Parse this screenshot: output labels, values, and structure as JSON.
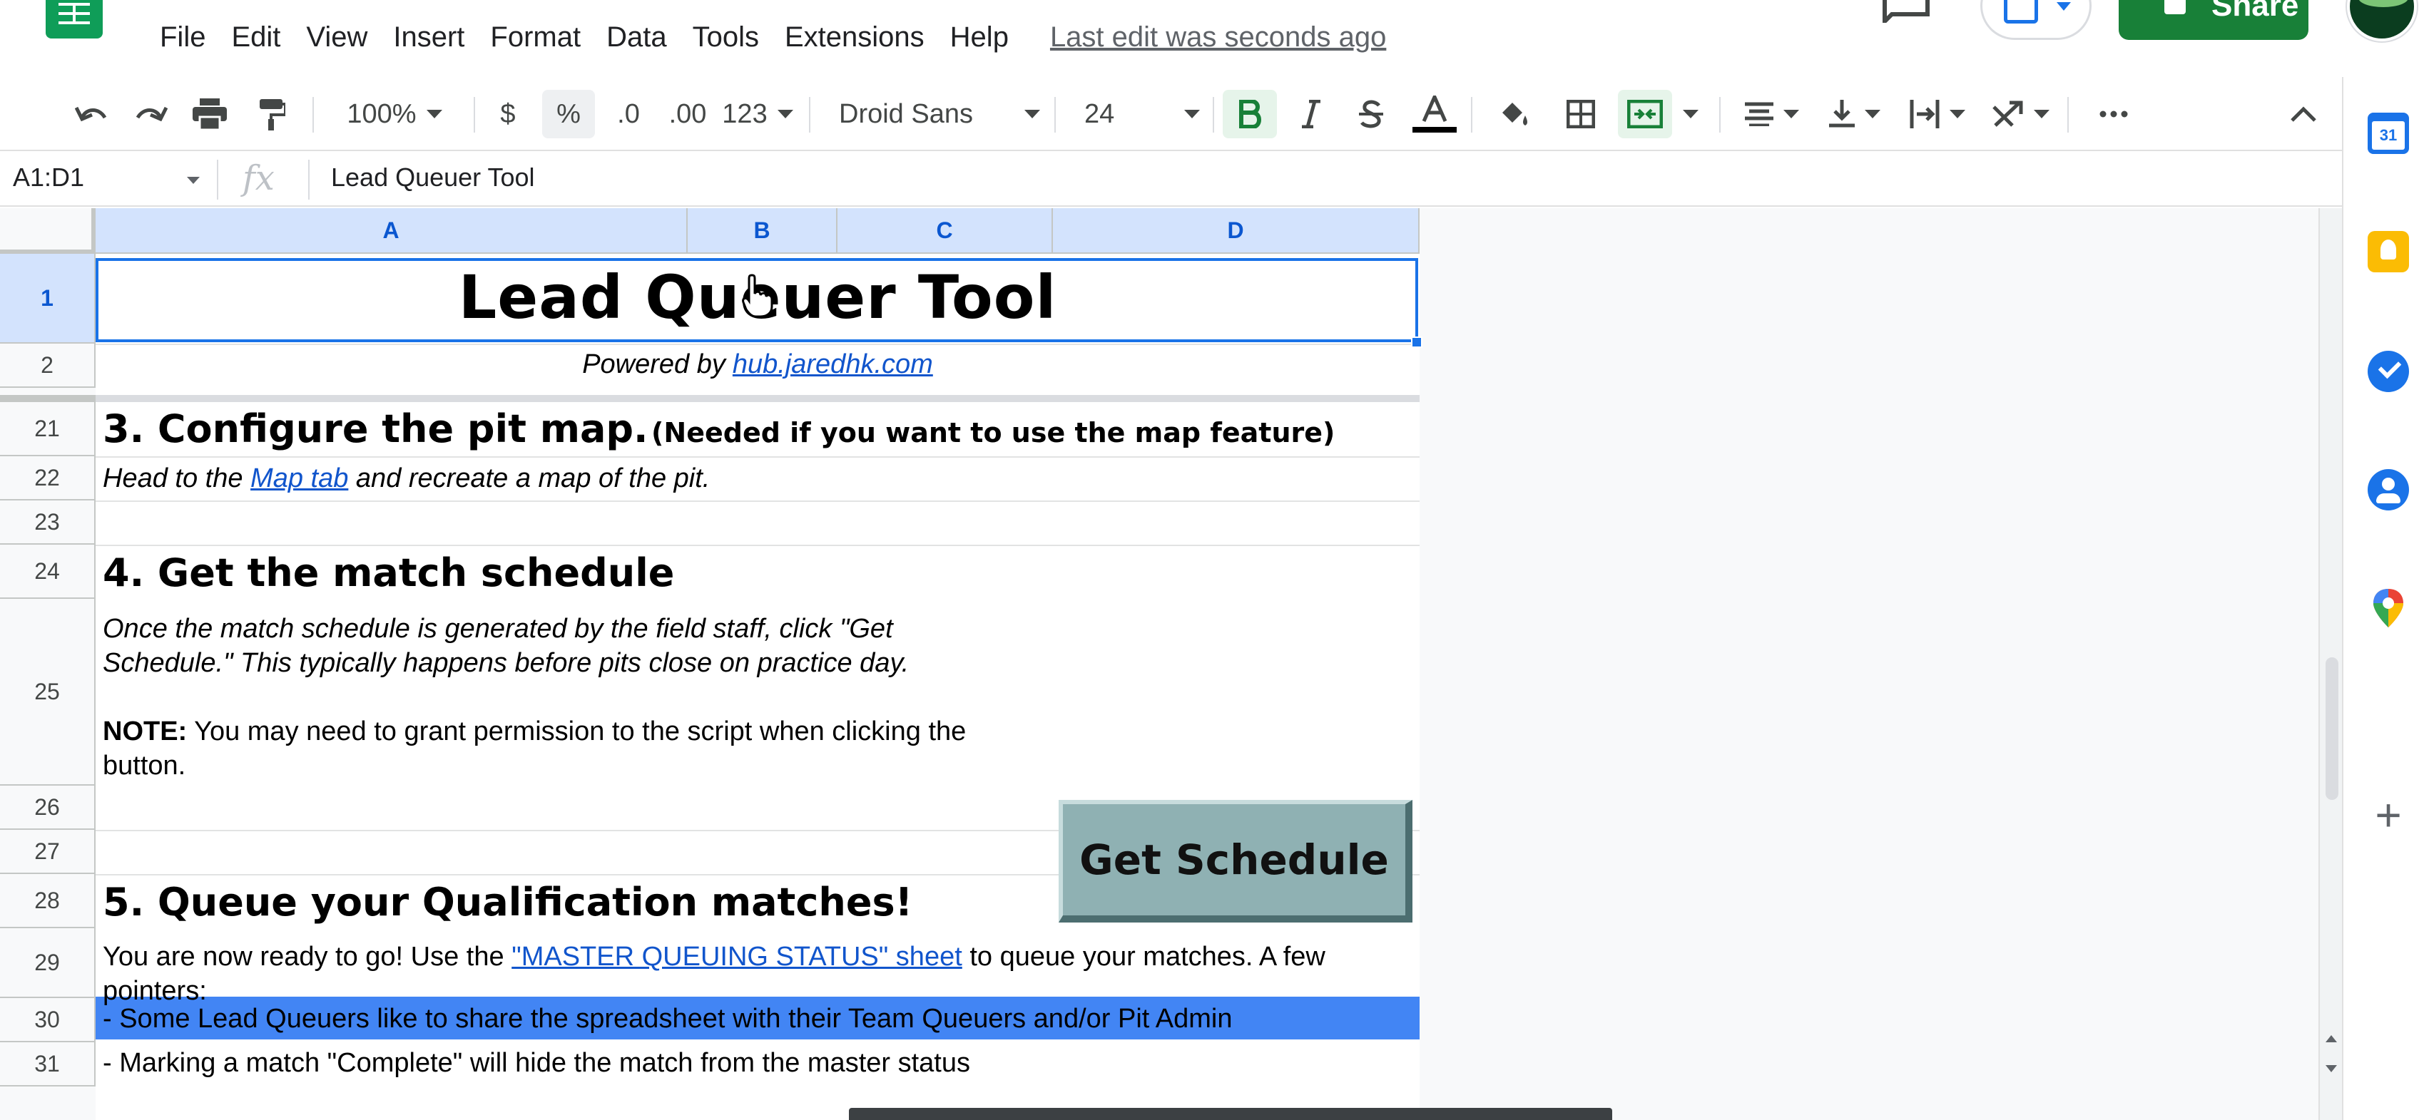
{
  "menu": {
    "items": [
      "File",
      "Edit",
      "View",
      "Insert",
      "Format",
      "Data",
      "Tools",
      "Extensions",
      "Help"
    ],
    "last_edit": "Last edit was seconds ago"
  },
  "header": {
    "share_label": "Share"
  },
  "toolbar": {
    "zoom": "100%",
    "currency": "$",
    "percent": "%",
    "decrease_decimal": ".0",
    "increase_decimal": ".00",
    "more_formats": "123",
    "font": "Droid Sans",
    "font_size": "24"
  },
  "formula_bar": {
    "name_box": "A1:D1",
    "fx": "fx",
    "content": "Lead Queuer Tool"
  },
  "columns": [
    "A",
    "B",
    "C",
    "D"
  ],
  "rows": [
    "1",
    "2",
    "21",
    "22",
    "23",
    "24",
    "25",
    "26",
    "27",
    "28",
    "29",
    "30",
    "31"
  ],
  "sheet": {
    "title": "Lead Queuer Tool",
    "powered_prefix": "Powered by",
    "powered_link": "hub.jaredhk.com",
    "step3_heading": "3. Configure the pit map.",
    "step3_note": "(Needed if you want to use the map feature)",
    "step3_text_before": "Head to the",
    "step3_link": "Map tab",
    "step3_text_after": "and recreate a map of the pit.",
    "step4_heading": "4. Get the match schedule",
    "step4_line1": "Once the match schedule is generated by the field staff, click \"Get",
    "step4_line2": "Schedule.\" This typically happens before pits close on practice day.",
    "note_label": "NOTE:",
    "note_line1": "You may need to grant permission to the script when clicking the",
    "note_line2": "button.",
    "get_schedule_button": "Get Schedule",
    "step5_heading": "5. Queue your Qualification matches!",
    "step5_line1_before": "You are now ready to go! Use  the",
    "step5_link": "\"MASTER QUEUING STATUS\" sheet",
    "step5_line1_after": "to queue your matches. A few",
    "step5_line2": "pointers:",
    "pointer1": "- Some Lead Queuers like to share the spreadsheet with their Team Queuers and/or Pit Admin",
    "pointer2": "- Marking a match \"Complete\" will hide the match from the master status"
  },
  "side_panel": {
    "calendar_day": "31"
  },
  "colors": {
    "accent": "#1a73e8",
    "share": "#188038",
    "blue_band": "#4285f4",
    "link": "#1155cc",
    "button_face": "#8fb1b3"
  }
}
